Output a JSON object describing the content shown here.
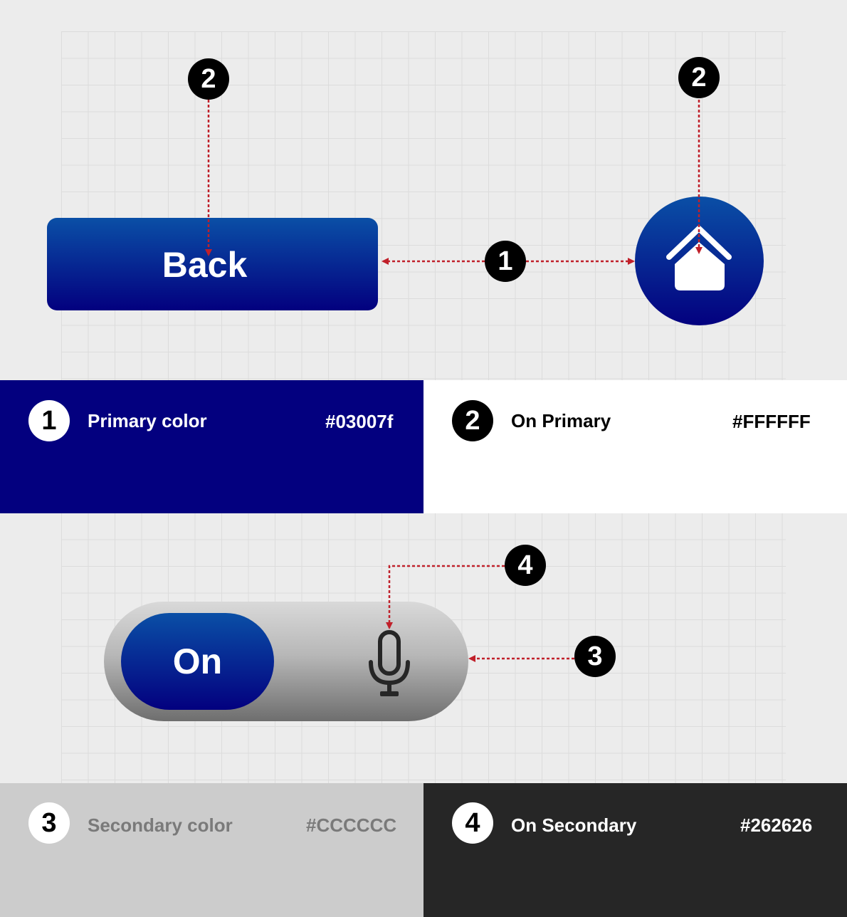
{
  "buttons": {
    "back_label": "Back",
    "toggle_label": "On"
  },
  "markers": {
    "back": "2",
    "home": "2",
    "primary": "1",
    "mic": "4",
    "toggle": "3"
  },
  "swatches": [
    {
      "number": "1",
      "name": "Primary color",
      "hex": "#03007f"
    },
    {
      "number": "2",
      "name": "On Primary",
      "hex": "#FFFFFF"
    },
    {
      "number": "3",
      "name": "Secondary color",
      "hex": "#CCCCCC"
    },
    {
      "number": "4",
      "name": "On Secondary",
      "hex": "#262626"
    }
  ],
  "colors": {
    "primary": "#03007f",
    "on_primary": "#FFFFFF",
    "secondary": "#CCCCCC",
    "on_secondary": "#262626",
    "annotation_arrow": "#c0202a"
  },
  "icons": {
    "home_button": "home-icon",
    "toggle_right": "microphone-icon"
  }
}
